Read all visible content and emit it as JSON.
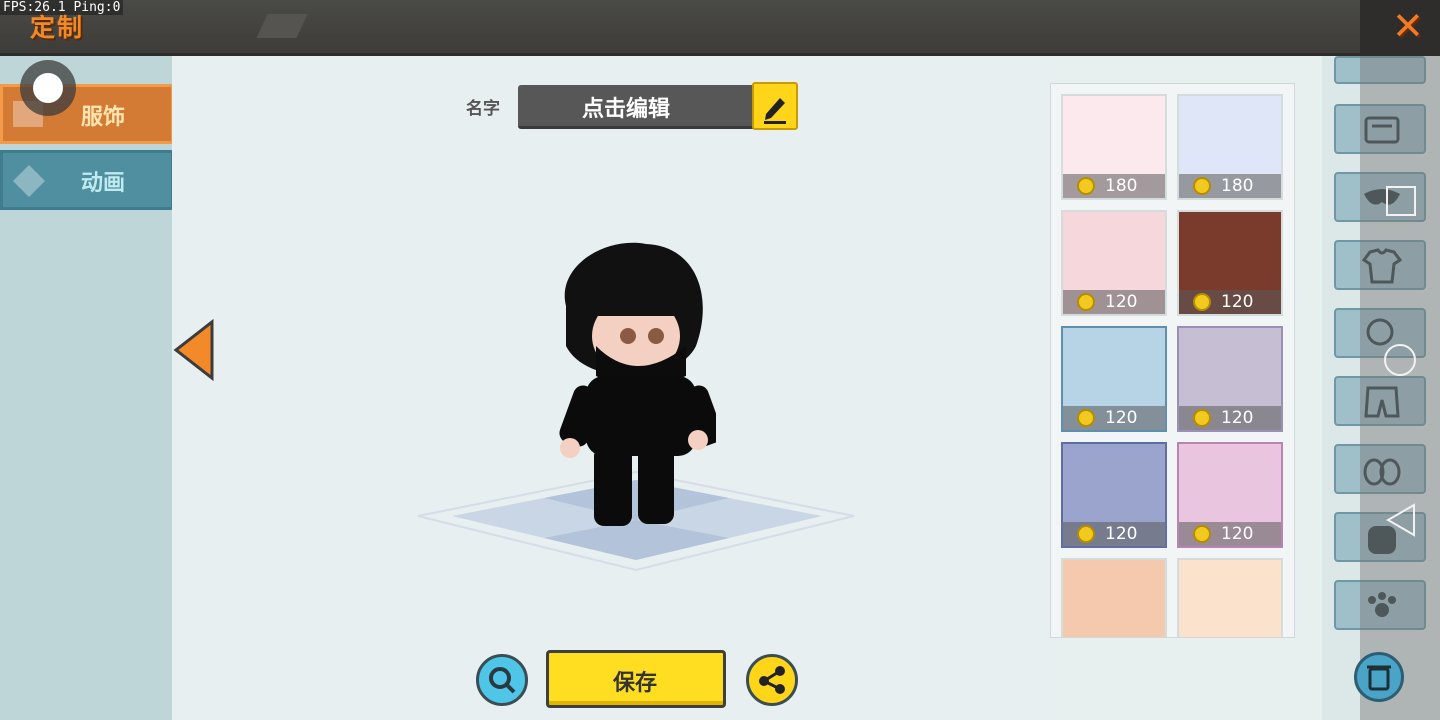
{
  "status": {
    "fps_text": "FPS:26.1  Ping:0"
  },
  "header": {
    "title": "定制",
    "close_icon": "close-x-icon"
  },
  "sidebar": {
    "tabs": [
      {
        "label": "服饰",
        "active": true
      },
      {
        "label": "动画",
        "active": false
      }
    ]
  },
  "editor": {
    "name_label": "名字",
    "name_value": "点击编辑",
    "save_label": "保存"
  },
  "catalog": {
    "items": [
      {
        "price": "180",
        "color": "#fbe9ee"
      },
      {
        "price": "180",
        "color": "#dfe6f7"
      },
      {
        "price": "120",
        "color": "#f6d7dc"
      },
      {
        "price": "120",
        "color": "#7a3a2c"
      },
      {
        "price": "120",
        "color": "#b7d3e6"
      },
      {
        "price": "120",
        "color": "#c6bfd3"
      },
      {
        "price": "120",
        "color": "#9aa4cc"
      },
      {
        "price": "120",
        "color": "#e9c5e0"
      },
      {
        "price": "",
        "color": "#f5c9ad"
      },
      {
        "price": "",
        "color": "#fbe2cd"
      }
    ]
  },
  "categories": [
    "frame-icon",
    "mask-icon",
    "shirt-icon",
    "glove-icon",
    "shorts-icon",
    "shoes-icon",
    "backpack-icon",
    "paw-icon"
  ],
  "colors": {
    "accent_orange": "#f08a28",
    "save_yellow": "#ffde22",
    "tab_blue": "#4f8fa0"
  }
}
